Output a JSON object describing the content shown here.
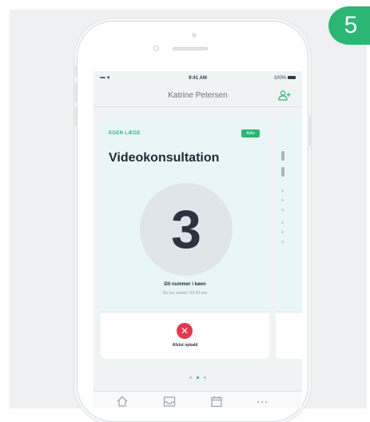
{
  "step_number": "5",
  "status_bar": {
    "signal": "•••• ▼",
    "time": "9:41 AM",
    "battery": "100%"
  },
  "header": {
    "title": "Katrine Petersen",
    "action_icon": "person-add-icon"
  },
  "card": {
    "label": "EGEN LÆGE",
    "tag": "Aktiv",
    "heading": "Videokonsultation",
    "queue_number": "3",
    "queue_label": "Dit nummer i køen",
    "queue_sub": "Du har ventet i 03:28 min",
    "cancel_label": "Afslut opkald",
    "cancel_icon": "close-icon"
  },
  "pager": {
    "count": 3,
    "active_index": 1
  },
  "tab_bar": {
    "items": [
      "home-icon",
      "inbox-icon",
      "calendar-icon",
      "more-icon"
    ]
  },
  "colors": {
    "accent": "#2bb673",
    "danger": "#e33950",
    "card_bg": "#e9f6f8",
    "text_dark": "#1f2a35"
  }
}
